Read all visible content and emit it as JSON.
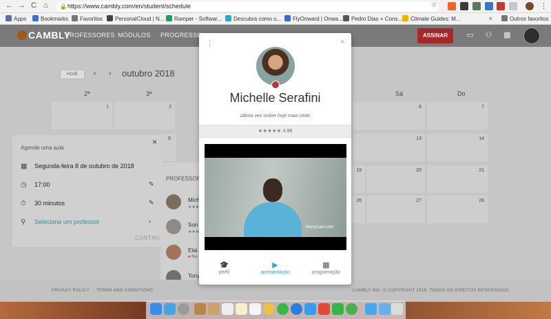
{
  "browser": {
    "url": "https://www.cambly.com/en/student/schedule",
    "nav": {
      "back": "←",
      "forward": "→",
      "reload": "C",
      "home": "⌂"
    },
    "bookmarks": [
      {
        "label": "Apps",
        "color": "#5f6ea0"
      },
      {
        "label": "Bookmarks",
        "color": "#3a6fd8"
      },
      {
        "label": "Favoritos",
        "color": "#777"
      },
      {
        "label": "PersonalCloud | N...",
        "color": "#444"
      },
      {
        "label": "Ramper - Softwar...",
        "color": "#1e9e5a"
      },
      {
        "label": "Descubra como u...",
        "color": "#29a8c9"
      },
      {
        "label": "FlyOnward | Onwa...",
        "color": "#2c6bd8"
      },
      {
        "label": "Pedro Dias + Cons...",
        "color": "#555"
      },
      {
        "label": "Climate Guides: M...",
        "color": "#f0b400"
      }
    ],
    "more_bookmarks": "»",
    "other_bookmarks": "Outros favoritos"
  },
  "header": {
    "logo": "CAMBLY",
    "nav": [
      "PROFESSORES",
      "MÓDULOS",
      "PROGRESSO"
    ],
    "subscribe": "ASSINAR",
    "icons": [
      "chat-icon",
      "people-icon",
      "calendar-icon"
    ]
  },
  "calendar": {
    "today": "HOJE",
    "prev": "‹",
    "next": "›",
    "month": "outubro 2018",
    "day_headers": [
      "2ª",
      "3ª",
      "Sá",
      "Do"
    ],
    "cells": [
      {
        "n": "1"
      },
      {
        "n": "2"
      },
      {
        "n": "6"
      },
      {
        "n": "7"
      },
      {
        "n": "9"
      },
      {
        "n": "13"
      },
      {
        "n": "14"
      },
      {
        "n": "19"
      },
      {
        "n": "20"
      },
      {
        "n": "21"
      },
      {
        "n": "26"
      },
      {
        "n": "27"
      },
      {
        "n": "28"
      }
    ]
  },
  "booking": {
    "title": "Agende uma aula",
    "close": "×",
    "date": "Segunda-feira 8 de outubro de 2018",
    "time": "17:00",
    "duration": "30 minutos",
    "select_teacher": "Selecione um professor",
    "continue": "CONTINUAR"
  },
  "teachers_panel": {
    "title": "PROFESSORES",
    "items": [
      {
        "name": "Mich",
        "sub": "★★★"
      },
      {
        "name": "Son",
        "sub": "★★★"
      },
      {
        "name": "Elai",
        "sub": "● Na"
      },
      {
        "name": "Tony",
        "sub": ""
      }
    ]
  },
  "footer": {
    "privacy": "PRIVACY POLICY",
    "terms": "TERMS AND CONDITIONS",
    "copyright": "CAMBLY INC. © COPYRIGHT 2018. TODOS OS DIREITOS RESERVADOS."
  },
  "modal": {
    "menu": "⋮",
    "close": "×",
    "name": "Michelle Serafini",
    "status": "última vez online hoje mais cedo",
    "stars": "★★★★★",
    "rating": "4.98",
    "video_watermark": "ManyCam.com",
    "tabs": [
      {
        "label": "perfil",
        "icon": "graduation-cap-icon",
        "glyph": "🎓"
      },
      {
        "label": "apresentação",
        "icon": "play-icon",
        "glyph": "▶"
      },
      {
        "label": "programação",
        "icon": "calendar-icon",
        "glyph": "▦"
      }
    ],
    "active_tab": "apresentação"
  }
}
